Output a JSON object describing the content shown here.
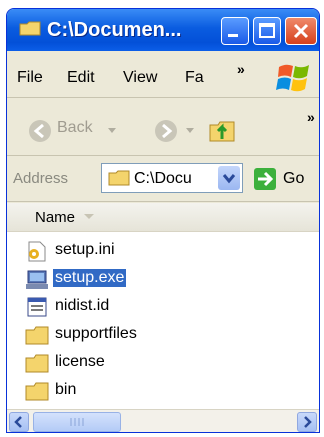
{
  "window": {
    "title": "C:\\Documen..."
  },
  "menubar": {
    "items": [
      "File",
      "Edit",
      "View",
      "Fa"
    ],
    "overflow": "»",
    "toolbar_overflow": "»"
  },
  "toolbar": {
    "back_label": "Back"
  },
  "address": {
    "label": "Address",
    "value": "C:\\Docu",
    "go_label": "Go"
  },
  "list": {
    "column_header": "Name",
    "items": [
      {
        "name": "setup.ini",
        "icon": "ini-file-icon",
        "selected": false
      },
      {
        "name": "setup.exe",
        "icon": "exe-file-icon",
        "selected": true
      },
      {
        "name": "nidist.id",
        "icon": "id-file-icon",
        "selected": false
      },
      {
        "name": "supportfiles",
        "icon": "folder-icon",
        "selected": false
      },
      {
        "name": "license",
        "icon": "folder-icon",
        "selected": false
      },
      {
        "name": "bin",
        "icon": "folder-icon",
        "selected": false
      }
    ]
  },
  "colors": {
    "titlebar": "#0350d8",
    "selection": "#316ac5",
    "chrome": "#ece9d8"
  }
}
